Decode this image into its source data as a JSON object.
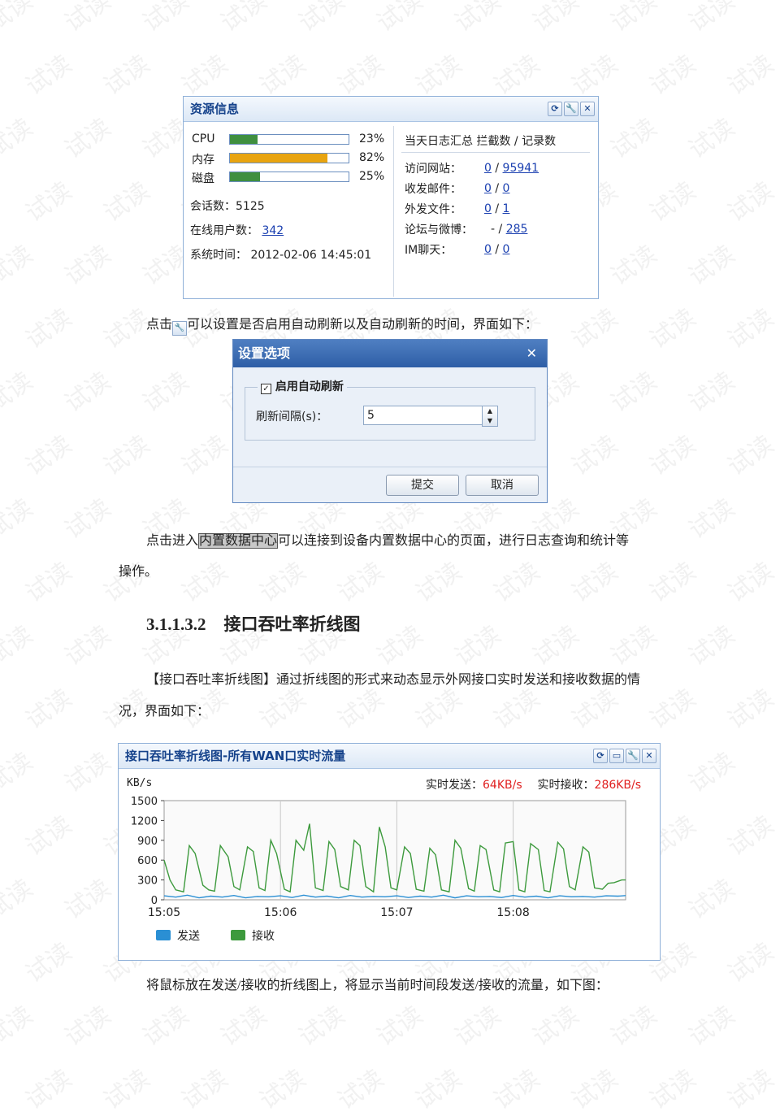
{
  "watermark": "试读",
  "resource_panel": {
    "title": "资源信息",
    "cpu_label": "CPU",
    "cpu_value": "23%",
    "cpu_fraction": 0.23,
    "mem_label": "内存",
    "mem_value": "82%",
    "mem_fraction": 0.82,
    "disk_label": "磁盘",
    "disk_value": "25%",
    "disk_fraction": 0.25,
    "session_label": "会话数：",
    "session_value": "5125",
    "online_label": "在线用户数：",
    "online_value": "342",
    "time_label": "系统时间：",
    "time_value": "2012-02-06 14:45:01",
    "log_header": "当天日志汇总  拦截数 / 记录数",
    "rows": [
      {
        "label": "访问网站：",
        "a": "0",
        "sep": "/",
        "b": "95941"
      },
      {
        "label": "收发邮件：",
        "a": "0",
        "sep": "/",
        "b": "0"
      },
      {
        "label": "外发文件：",
        "a": "0",
        "sep": "/",
        "b": "1"
      },
      {
        "label": "论坛与微博：",
        "a": "-",
        "sep": "/",
        "b": "285"
      },
      {
        "label": "IM聊天：",
        "a": "0",
        "sep": "/",
        "b": "0"
      }
    ]
  },
  "para1_before": "点击",
  "para1_after": "可以设置是否启用自动刷新以及自动刷新的时间，界面如下：",
  "dialog": {
    "title": "设置选项",
    "close": "✕",
    "checkbox_label": "启用自动刷新",
    "interval_label": "刷新间隔(s)：",
    "interval_value": "5",
    "submit": "提交",
    "cancel": "取消"
  },
  "para2_before": "点击进入",
  "para2_highlight": "内置数据中心",
  "para2_after": "可以连接到设备内置数据中心的页面，进行日志查询和统计等",
  "para2_line2": "操作。",
  "heading_num": "3.1.1.3.2",
  "heading_text": "接口吞吐率折线图",
  "para3_line1": "【接口吞吐率折线图】通过折线图的形式来动态显示外网接口实时发送和接收数据的情",
  "para3_line2": "况，界面如下：",
  "chart_panel": {
    "title": "接口吞吐率折线图-所有WAN口实时流量",
    "send_label": "实时发送：",
    "send_value": "64KB/s",
    "recv_label": "实时接收：",
    "recv_value": "286KB/s",
    "send_color": "#e02020",
    "recv_color": "#e02020"
  },
  "chart_data": {
    "type": "line",
    "ylabel": "KB/s",
    "ylim": [
      0,
      1500
    ],
    "yticks": [
      "1500",
      "1200",
      "900",
      "600",
      "300",
      "0"
    ],
    "ytick_values": [
      1500,
      1200,
      900,
      600,
      300,
      0
    ],
    "xticks": [
      "15:05",
      "15:06",
      "15:07",
      "15:08"
    ],
    "xtick_seconds": [
      0,
      60,
      120,
      180
    ],
    "xmax_seconds": 238,
    "grid": true,
    "legend": "bottom-left",
    "series": [
      {
        "name": "发送",
        "color": "#2a8fd4",
        "x": [
          0,
          6,
          12,
          18,
          24,
          30,
          36,
          42,
          48,
          54,
          60,
          66,
          72,
          78,
          84,
          90,
          96,
          102,
          108,
          114,
          120,
          126,
          132,
          138,
          144,
          150,
          156,
          162,
          168,
          174,
          180,
          186,
          192,
          198,
          204,
          210,
          216,
          222,
          228,
          234,
          238
        ],
        "y": [
          60,
          40,
          70,
          30,
          55,
          40,
          65,
          30,
          50,
          45,
          60,
          35,
          70,
          40,
          55,
          30,
          65,
          40,
          50,
          45,
          60,
          35,
          55,
          40,
          70,
          30,
          60,
          45,
          50,
          35,
          65,
          40,
          55,
          30,
          60,
          45,
          50,
          40,
          60,
          55,
          64
        ]
      },
      {
        "name": "接收",
        "color": "#3d9a3d",
        "x": [
          0,
          3,
          6,
          10,
          13,
          16,
          20,
          23,
          26,
          29,
          33,
          36,
          39,
          43,
          46,
          49,
          52,
          55,
          58,
          62,
          65,
          68,
          72,
          75,
          78,
          82,
          85,
          88,
          91,
          95,
          98,
          101,
          104,
          108,
          111,
          114,
          117,
          120,
          124,
          127,
          130,
          134,
          137,
          140,
          143,
          147,
          150,
          153,
          157,
          160,
          163,
          166,
          170,
          173,
          176,
          180,
          183,
          186,
          189,
          193,
          196,
          199,
          203,
          206,
          209,
          212,
          216,
          219,
          222,
          226,
          229,
          232,
          236,
          238
        ],
        "y": [
          600,
          300,
          150,
          120,
          820,
          700,
          220,
          150,
          130,
          820,
          650,
          200,
          150,
          800,
          730,
          180,
          140,
          900,
          700,
          160,
          120,
          900,
          750,
          1150,
          180,
          140,
          880,
          760,
          200,
          150,
          900,
          820,
          200,
          120,
          1100,
          800,
          180,
          150,
          800,
          700,
          160,
          130,
          780,
          680,
          150,
          120,
          900,
          780,
          170,
          130,
          820,
          760,
          150,
          120,
          860,
          880,
          150,
          120,
          850,
          760,
          140,
          120,
          870,
          770,
          200,
          150,
          800,
          720,
          180,
          160,
          250,
          260,
          300,
          300
        ]
      }
    ]
  },
  "para4": "将鼠标放在发送/接收的折线图上，将显示当前时间段发送/接收的流量，如下图："
}
